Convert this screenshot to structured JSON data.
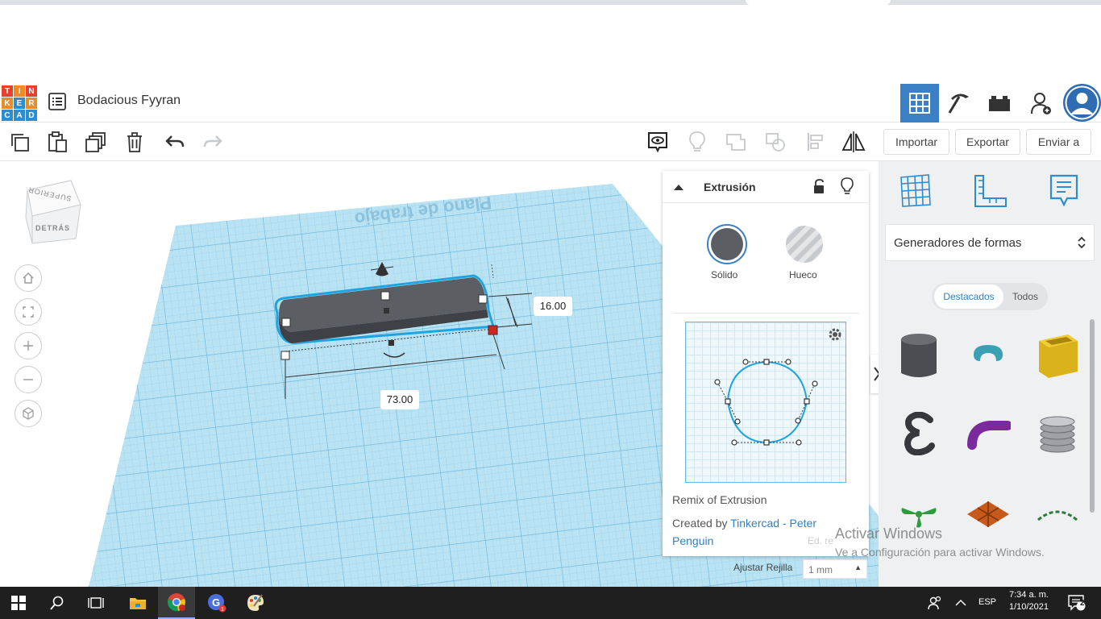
{
  "app": {
    "logo_letters": [
      "T",
      "I",
      "N",
      "K",
      "E",
      "R",
      "C",
      "A",
      "D"
    ],
    "design_title": "Bodacious Fyyran"
  },
  "toolbar": {
    "import_label": "Importar",
    "export_label": "Exportar",
    "send_label": "Enviar a"
  },
  "viewcube": {
    "top_label": "SUPERIOR",
    "back_label": "DETRÁS"
  },
  "workplane": {
    "label": "Plano de trabajo",
    "dim_length": "73.00",
    "dim_height": "16.00"
  },
  "inspector": {
    "title": "Extrusión",
    "solid_label": "Sólido",
    "hole_label": "Hueco",
    "remix_text": "Remix of Extrusion",
    "created_by": "Created by",
    "author": "Tinkercad - Peter Penguin",
    "edit_text": "Ed. re"
  },
  "grid": {
    "snap_label": "Ajustar Rejilla",
    "snap_value": "1 mm"
  },
  "shapes_panel": {
    "category": "Generadores de formas",
    "tab_featured": "Destacados",
    "tab_all": "Todos"
  },
  "watermark": {
    "line1": "Activar Windows",
    "line2": "Ve a Configuración para activar Windows."
  },
  "taskbar": {
    "lang": "ESP",
    "time": "7:34 a. m.",
    "date": "1/10/2021",
    "notif_count": "2"
  },
  "colors": {
    "tinkercad_red": "#e8402f",
    "tinkercad_orange": "#f08a24",
    "tinkercad_blue": "#2f8ccf",
    "workplane_blue": "#b9e2f3",
    "selection_blue": "#1ea4e0",
    "accent_blue": "#3b7fc4"
  }
}
